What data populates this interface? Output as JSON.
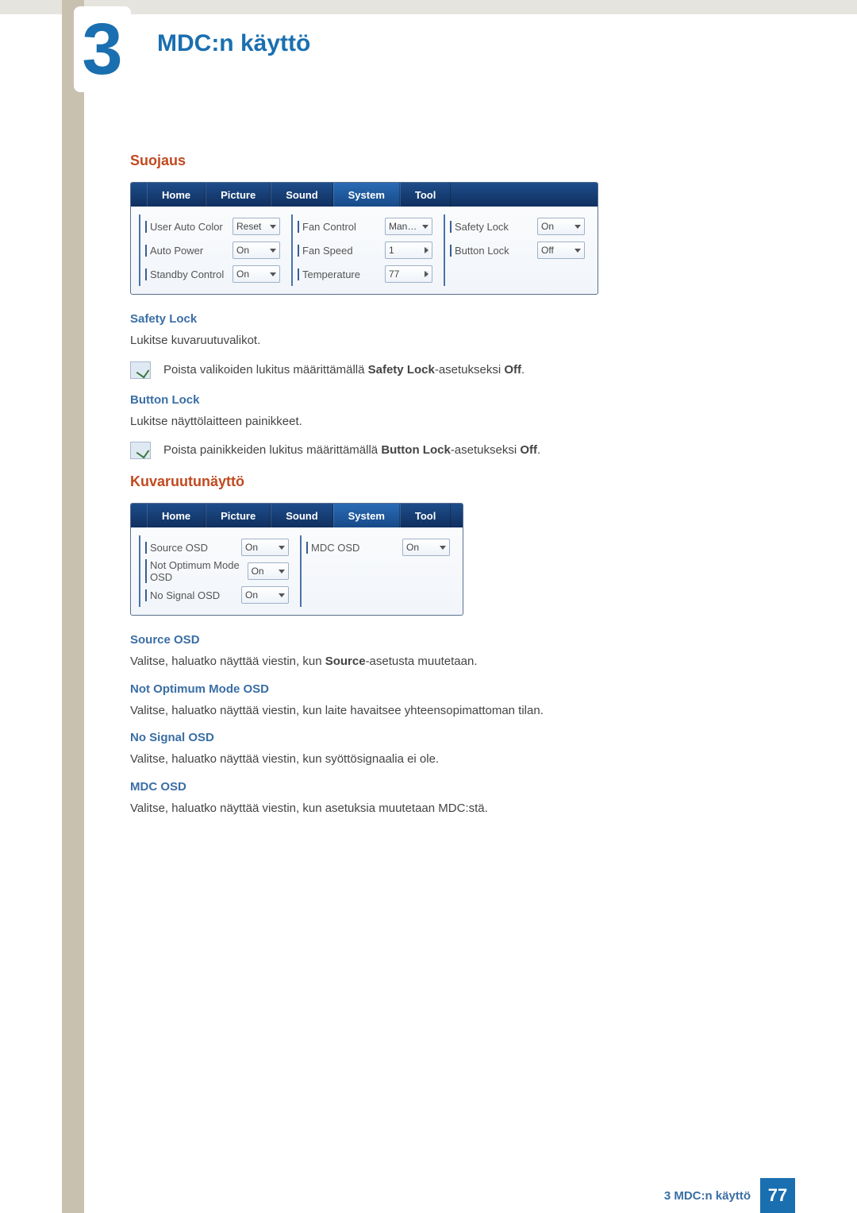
{
  "chapter": {
    "number": "3",
    "title": "MDC:n käyttö"
  },
  "section1": {
    "heading": "Suojaus",
    "tabs": [
      "Home",
      "Picture",
      "Sound",
      "System",
      "Tool"
    ],
    "active_tab": "System",
    "cols": [
      [
        {
          "label": "User Auto Color",
          "value": "Reset",
          "type": "caret"
        },
        {
          "label": "Auto Power",
          "value": "On",
          "type": "caret"
        },
        {
          "label": "Standby Control",
          "value": "On",
          "type": "caret"
        }
      ],
      [
        {
          "label": "Fan Control",
          "value": "Man…",
          "type": "caret"
        },
        {
          "label": "Fan Speed",
          "value": "1",
          "type": "arrow"
        },
        {
          "label": "Temperature",
          "value": "77",
          "type": "arrow"
        }
      ],
      [
        {
          "label": "Safety Lock",
          "value": "On",
          "type": "caret"
        },
        {
          "label": "Button Lock",
          "value": "Off",
          "type": "caret"
        }
      ]
    ],
    "sub1": {
      "h": "Safety Lock",
      "p": "Lukitse kuvaruutuvalikot.",
      "note_pre": "Poista valikoiden lukitus määrittämällä ",
      "note_b": "Safety Lock",
      "note_mid": "-asetukseksi ",
      "note_b2": "Off",
      "note_end": "."
    },
    "sub2": {
      "h": "Button Lock",
      "p": "Lukitse näyttölaitteen painikkeet.",
      "note_pre": "Poista painikkeiden lukitus määrittämällä ",
      "note_b": "Button Lock",
      "note_mid": "-asetukseksi ",
      "note_b2": "Off",
      "note_end": "."
    }
  },
  "section2": {
    "heading": "Kuvaruutunäyttö",
    "tabs": [
      "Home",
      "Picture",
      "Sound",
      "System",
      "Tool"
    ],
    "active_tab": "System",
    "cols": [
      [
        {
          "label": "Source OSD",
          "value": "On",
          "type": "caret"
        },
        {
          "label": "Not Optimum Mode OSD",
          "value": "On",
          "type": "caret"
        },
        {
          "label": "No Signal OSD",
          "value": "On",
          "type": "caret"
        }
      ],
      [
        {
          "label": "MDC OSD",
          "value": "On",
          "type": "caret"
        }
      ]
    ],
    "items": [
      {
        "h": "Source OSD",
        "p_pre": "Valitse, haluatko näyttää viestin, kun ",
        "p_b": "Source",
        "p_post": "-asetusta muutetaan."
      },
      {
        "h": "Not Optimum Mode OSD",
        "p_pre": "Valitse, haluatko näyttää viestin, kun laite havaitsee yhteensopimattoman tilan.",
        "p_b": "",
        "p_post": ""
      },
      {
        "h": "No Signal OSD",
        "p_pre": "Valitse, haluatko näyttää viestin, kun syöttösignaalia ei ole.",
        "p_b": "",
        "p_post": ""
      },
      {
        "h": "MDC OSD",
        "p_pre": "Valitse, haluatko näyttää viestin, kun asetuksia muutetaan MDC:stä.",
        "p_b": "",
        "p_post": ""
      }
    ]
  },
  "footer": {
    "text": "3 MDC:n käyttö",
    "page": "77"
  }
}
